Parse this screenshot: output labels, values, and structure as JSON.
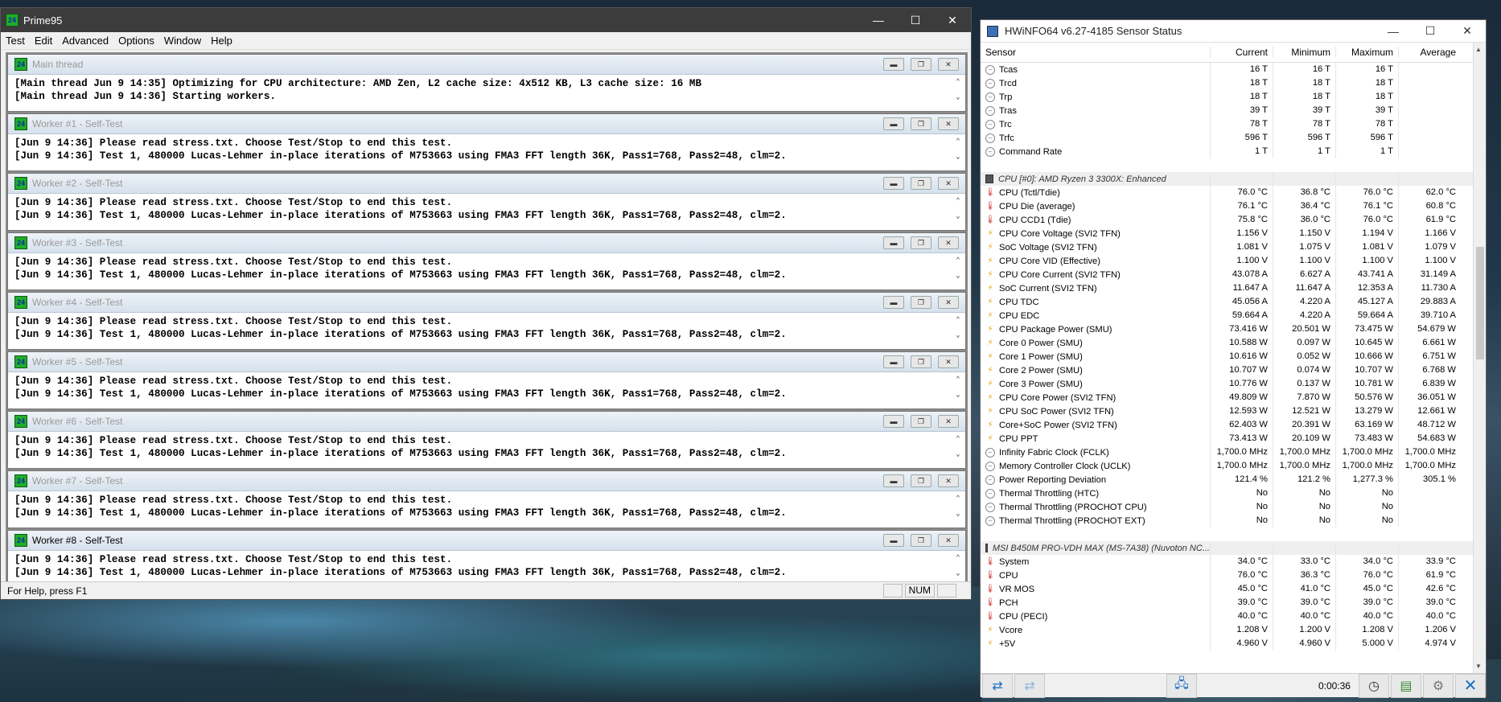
{
  "prime95": {
    "title": "Prime95",
    "logo": "24",
    "controls": {
      "minimize": "—",
      "maximize": "☐",
      "close": "✕"
    },
    "menu": [
      "Test",
      "Edit",
      "Advanced",
      "Options",
      "Window",
      "Help"
    ],
    "workers": [
      {
        "name": "Main thread",
        "lines": [
          "[Main thread Jun 9 14:35] Optimizing for CPU architecture: AMD Zen, L2 cache size: 4x512 KB, L3 cache size: 16 MB",
          "[Main thread Jun 9 14:36] Starting workers."
        ]
      },
      {
        "name": "Worker #1 - Self-Test",
        "lines": [
          "[Jun 9 14:36] Please read stress.txt.  Choose Test/Stop to end this test.",
          "[Jun 9 14:36] Test 1, 480000 Lucas-Lehmer in-place iterations of M753663 using FMA3 FFT length 36K, Pass1=768, Pass2=48, clm=2."
        ]
      },
      {
        "name": "Worker #2 - Self-Test",
        "lines": [
          "[Jun 9 14:36] Please read stress.txt.  Choose Test/Stop to end this test.",
          "[Jun 9 14:36] Test 1, 480000 Lucas-Lehmer in-place iterations of M753663 using FMA3 FFT length 36K, Pass1=768, Pass2=48, clm=2."
        ]
      },
      {
        "name": "Worker #3 - Self-Test",
        "lines": [
          "[Jun 9 14:36] Please read stress.txt.  Choose Test/Stop to end this test.",
          "[Jun 9 14:36] Test 1, 480000 Lucas-Lehmer in-place iterations of M753663 using FMA3 FFT length 36K, Pass1=768, Pass2=48, clm=2."
        ]
      },
      {
        "name": "Worker #4 - Self-Test",
        "lines": [
          "[Jun 9 14:36] Please read stress.txt.  Choose Test/Stop to end this test.",
          "[Jun 9 14:36] Test 1, 480000 Lucas-Lehmer in-place iterations of M753663 using FMA3 FFT length 36K, Pass1=768, Pass2=48, clm=2."
        ]
      },
      {
        "name": "Worker #5 - Self-Test",
        "lines": [
          "[Jun 9 14:36] Please read stress.txt.  Choose Test/Stop to end this test.",
          "[Jun 9 14:36] Test 1, 480000 Lucas-Lehmer in-place iterations of M753663 using FMA3 FFT length 36K, Pass1=768, Pass2=48, clm=2."
        ]
      },
      {
        "name": "Worker #6 - Self-Test",
        "lines": [
          "[Jun 9 14:36] Please read stress.txt.  Choose Test/Stop to end this test.",
          "[Jun 9 14:36] Test 1, 480000 Lucas-Lehmer in-place iterations of M753663 using FMA3 FFT length 36K, Pass1=768, Pass2=48, clm=2."
        ]
      },
      {
        "name": "Worker #7 - Self-Test",
        "lines": [
          "[Jun 9 14:36] Please read stress.txt.  Choose Test/Stop to end this test.",
          "[Jun 9 14:36] Test 1, 480000 Lucas-Lehmer in-place iterations of M753663 using FMA3 FFT length 36K, Pass1=768, Pass2=48, clm=2."
        ]
      },
      {
        "name": "Worker #8 - Self-Test",
        "lines": [
          "[Jun 9 14:36] Please read stress.txt.  Choose Test/Stop to end this test.",
          "[Jun 9 14:36] Test 1, 480000 Lucas-Lehmer in-place iterations of M753663 using FMA3 FFT length 36K, Pass1=768, Pass2=48, clm=2."
        ]
      }
    ],
    "status": {
      "help": "For Help, press F1",
      "num": "NUM"
    }
  },
  "hwinfo": {
    "title": "HWiNFO64 v6.27-4185 Sensor Status",
    "columns": [
      "Sensor",
      "Current",
      "Minimum",
      "Maximum",
      "Average"
    ],
    "rows": [
      {
        "icon": "circle",
        "name": "Tcas",
        "cur": "16 T",
        "min": "16 T",
        "max": "16 T",
        "avg": ""
      },
      {
        "icon": "circle",
        "name": "Trcd",
        "cur": "18 T",
        "min": "18 T",
        "max": "18 T",
        "avg": ""
      },
      {
        "icon": "circle",
        "name": "Trp",
        "cur": "18 T",
        "min": "18 T",
        "max": "18 T",
        "avg": ""
      },
      {
        "icon": "circle",
        "name": "Tras",
        "cur": "39 T",
        "min": "39 T",
        "max": "39 T",
        "avg": ""
      },
      {
        "icon": "circle",
        "name": "Trc",
        "cur": "78 T",
        "min": "78 T",
        "max": "78 T",
        "avg": ""
      },
      {
        "icon": "circle",
        "name": "Trfc",
        "cur": "596 T",
        "min": "596 T",
        "max": "596 T",
        "avg": ""
      },
      {
        "icon": "circle",
        "name": "Command Rate",
        "cur": "1 T",
        "min": "1 T",
        "max": "1 T",
        "avg": ""
      },
      {
        "type": "blank"
      },
      {
        "type": "group",
        "name": "CPU [#0]: AMD Ryzen 3 3300X: Enhanced"
      },
      {
        "icon": "therm",
        "name": "CPU (Tctl/Tdie)",
        "cur": "76.0 °C",
        "min": "36.8 °C",
        "max": "76.0 °C",
        "avg": "62.0 °C"
      },
      {
        "icon": "therm",
        "name": "CPU Die (average)",
        "cur": "76.1 °C",
        "min": "36.4 °C",
        "max": "76.1 °C",
        "avg": "60.8 °C"
      },
      {
        "icon": "therm",
        "name": "CPU CCD1 (Tdie)",
        "cur": "75.8 °C",
        "min": "36.0 °C",
        "max": "76.0 °C",
        "avg": "61.9 °C"
      },
      {
        "icon": "bolt",
        "name": "CPU Core Voltage (SVI2 TFN)",
        "cur": "1.156 V",
        "min": "1.150 V",
        "max": "1.194 V",
        "avg": "1.166 V"
      },
      {
        "icon": "bolt",
        "name": "SoC Voltage (SVI2 TFN)",
        "cur": "1.081 V",
        "min": "1.075 V",
        "max": "1.081 V",
        "avg": "1.079 V"
      },
      {
        "icon": "bolt",
        "name": "CPU Core VID (Effective)",
        "cur": "1.100 V",
        "min": "1.100 V",
        "max": "1.100 V",
        "avg": "1.100 V"
      },
      {
        "icon": "bolt",
        "name": "CPU Core Current (SVI2 TFN)",
        "cur": "43.078 A",
        "min": "6.627 A",
        "max": "43.741 A",
        "avg": "31.149 A"
      },
      {
        "icon": "bolt",
        "name": "SoC Current (SVI2 TFN)",
        "cur": "11.647 A",
        "min": "11.647 A",
        "max": "12.353 A",
        "avg": "11.730 A"
      },
      {
        "icon": "bolt",
        "name": "CPU TDC",
        "cur": "45.056 A",
        "min": "4.220 A",
        "max": "45.127 A",
        "avg": "29.883 A"
      },
      {
        "icon": "bolt",
        "name": "CPU EDC",
        "cur": "59.664 A",
        "min": "4.220 A",
        "max": "59.664 A",
        "avg": "39.710 A"
      },
      {
        "icon": "bolt",
        "name": "CPU Package Power (SMU)",
        "cur": "73.416 W",
        "min": "20.501 W",
        "max": "73.475 W",
        "avg": "54.679 W"
      },
      {
        "icon": "bolt",
        "name": "Core 0 Power (SMU)",
        "cur": "10.588 W",
        "min": "0.097 W",
        "max": "10.645 W",
        "avg": "6.661 W"
      },
      {
        "icon": "bolt",
        "name": "Core 1 Power (SMU)",
        "cur": "10.616 W",
        "min": "0.052 W",
        "max": "10.666 W",
        "avg": "6.751 W"
      },
      {
        "icon": "bolt",
        "name": "Core 2 Power (SMU)",
        "cur": "10.707 W",
        "min": "0.074 W",
        "max": "10.707 W",
        "avg": "6.768 W"
      },
      {
        "icon": "bolt",
        "name": "Core 3 Power (SMU)",
        "cur": "10.776 W",
        "min": "0.137 W",
        "max": "10.781 W",
        "avg": "6.839 W"
      },
      {
        "icon": "bolt",
        "name": "CPU Core Power (SVI2 TFN)",
        "cur": "49.809 W",
        "min": "7.870 W",
        "max": "50.576 W",
        "avg": "36.051 W"
      },
      {
        "icon": "bolt",
        "name": "CPU SoC Power (SVI2 TFN)",
        "cur": "12.593 W",
        "min": "12.521 W",
        "max": "13.279 W",
        "avg": "12.661 W"
      },
      {
        "icon": "bolt",
        "name": "Core+SoC Power (SVI2 TFN)",
        "cur": "62.403 W",
        "min": "20.391 W",
        "max": "63.169 W",
        "avg": "48.712 W"
      },
      {
        "icon": "bolt",
        "name": "CPU PPT",
        "cur": "73.413 W",
        "min": "20.109 W",
        "max": "73.483 W",
        "avg": "54.683 W"
      },
      {
        "icon": "circle",
        "name": "Infinity Fabric Clock (FCLK)",
        "cur": "1,700.0 MHz",
        "min": "1,700.0 MHz",
        "max": "1,700.0 MHz",
        "avg": "1,700.0 MHz"
      },
      {
        "icon": "circle",
        "name": "Memory Controller Clock (UCLK)",
        "cur": "1,700.0 MHz",
        "min": "1,700.0 MHz",
        "max": "1,700.0 MHz",
        "avg": "1,700.0 MHz"
      },
      {
        "icon": "circle",
        "name": "Power Reporting Deviation",
        "cur": "121.4 %",
        "min": "121.2 %",
        "max": "1,277.3 %",
        "avg": "305.1 %"
      },
      {
        "icon": "circle",
        "name": "Thermal Throttling (HTC)",
        "cur": "No",
        "min": "No",
        "max": "No",
        "avg": ""
      },
      {
        "icon": "circle",
        "name": "Thermal Throttling (PROCHOT CPU)",
        "cur": "No",
        "min": "No",
        "max": "No",
        "avg": ""
      },
      {
        "icon": "circle",
        "name": "Thermal Throttling (PROCHOT EXT)",
        "cur": "No",
        "min": "No",
        "max": "No",
        "avg": ""
      },
      {
        "type": "blank"
      },
      {
        "type": "group",
        "name": "MSI B450M PRO-VDH MAX (MS-7A38) (Nuvoton NC..."
      },
      {
        "icon": "therm",
        "name": "System",
        "cur": "34.0 °C",
        "min": "33.0 °C",
        "max": "34.0 °C",
        "avg": "33.9 °C"
      },
      {
        "icon": "therm",
        "name": "CPU",
        "cur": "76.0 °C",
        "min": "36.3 °C",
        "max": "76.0 °C",
        "avg": "61.9 °C"
      },
      {
        "icon": "therm",
        "name": "VR MOS",
        "cur": "45.0 °C",
        "min": "41.0 °C",
        "max": "45.0 °C",
        "avg": "42.6 °C"
      },
      {
        "icon": "therm",
        "name": "PCH",
        "cur": "39.0 °C",
        "min": "39.0 °C",
        "max": "39.0 °C",
        "avg": "39.0 °C"
      },
      {
        "icon": "therm",
        "name": "CPU (PECI)",
        "cur": "40.0 °C",
        "min": "40.0 °C",
        "max": "40.0 °C",
        "avg": "40.0 °C"
      },
      {
        "icon": "bolt",
        "name": "Vcore",
        "cur": "1.208 V",
        "min": "1.200 V",
        "max": "1.208 V",
        "avg": "1.206 V"
      },
      {
        "icon": "bolt",
        "name": "+5V",
        "cur": "4.960 V",
        "min": "4.960 V",
        "max": "5.000 V",
        "avg": "4.974 V"
      }
    ],
    "timer": "0:00:36"
  }
}
